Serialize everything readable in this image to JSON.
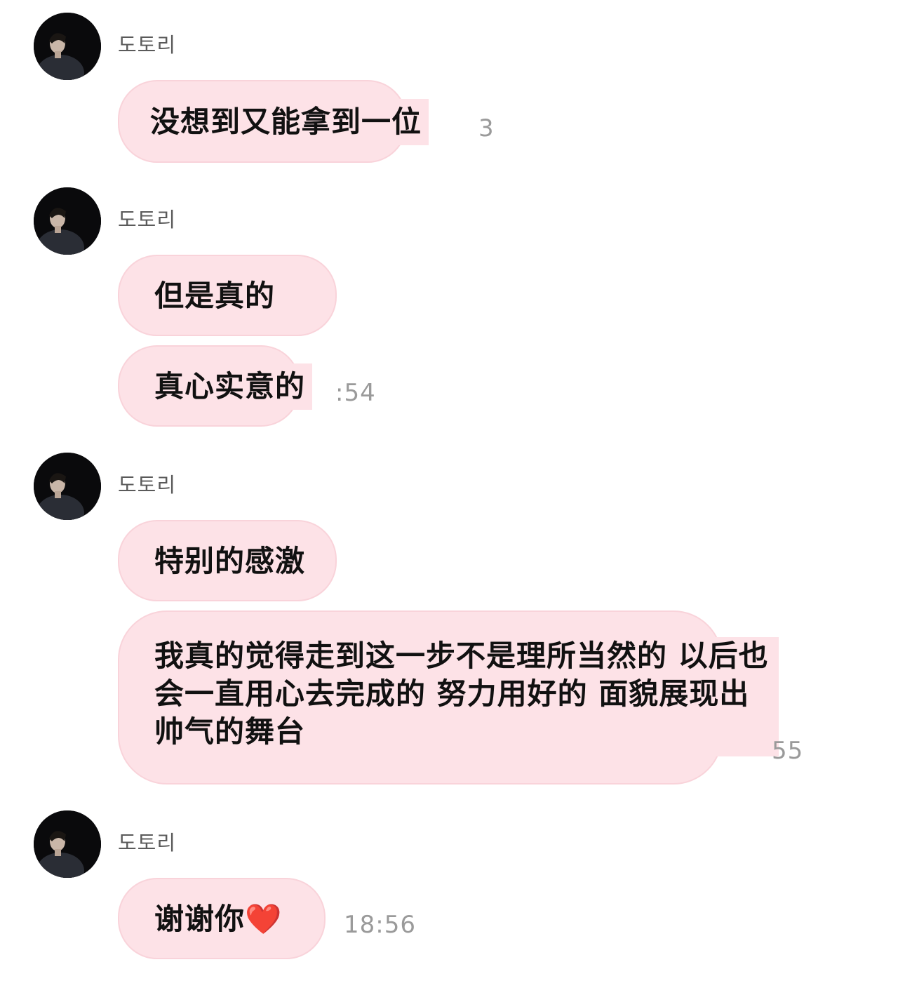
{
  "conversation": {
    "sender_name": "도토리",
    "groups": [
      {
        "messages": [
          {
            "text": "没想到又能拿到一位"
          }
        ],
        "time": "3"
      },
      {
        "messages": [
          {
            "text": "但是真的"
          },
          {
            "text": "真心实意的"
          }
        ],
        "time": ":54"
      },
      {
        "messages": [
          {
            "text": "特别的感激"
          },
          {
            "text": "我真的觉得走到这一步不是理所当然的 以后也会一直用心去完成的 努力用好的 面貌展现出帅气的舞台"
          }
        ],
        "time": "55"
      },
      {
        "messages": [
          {
            "text": "谢谢你",
            "emoji": "❤️"
          }
        ],
        "time": "18:56"
      }
    ]
  },
  "colors": {
    "bubble": "#fde2e7",
    "bubble_border": "#f9d3da",
    "timestamp": "#9a9a9a",
    "sender": "#5a5a5a",
    "heart": "#e8232f"
  },
  "icons": {
    "avatar": "profile-photo-avatar"
  }
}
